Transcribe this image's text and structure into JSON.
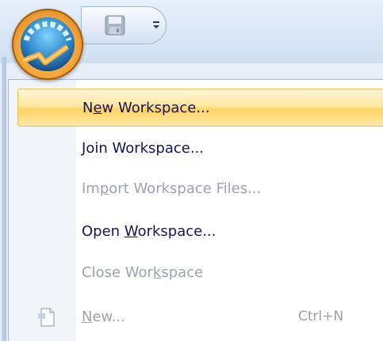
{
  "quick_access": {
    "save_icon": "save-icon",
    "customize_icon": "customize-toolbar-icon"
  },
  "office_button": {
    "icon": "application-orb-icon"
  },
  "menu": {
    "items": [
      {
        "label_pre": "N",
        "label_u": "e",
        "label_post": "w Workspace...",
        "enabled": true,
        "highlighted": true
      },
      {
        "label_pre": "",
        "label_u": "J",
        "label_post": "oin Workspace...",
        "enabled": true,
        "highlighted": false
      },
      {
        "label_pre": "Im",
        "label_u": "p",
        "label_post": "ort Workspace Files...",
        "enabled": false,
        "highlighted": false
      },
      {
        "label_pre": "Open ",
        "label_u": "W",
        "label_post": "orkspace...",
        "enabled": true,
        "highlighted": false
      },
      {
        "label_pre": "Close Wor",
        "label_u": "k",
        "label_post": "space",
        "enabled": false,
        "highlighted": false
      },
      {
        "label_pre": "",
        "label_u": "N",
        "label_post": "ew...",
        "enabled": false,
        "highlighted": false,
        "shortcut": "Ctrl+N",
        "icon": "new-document-icon"
      }
    ]
  },
  "colors": {
    "highlight": "#ffd466",
    "enabled_text": "#16144e",
    "disabled_text": "#9ea3ab"
  }
}
